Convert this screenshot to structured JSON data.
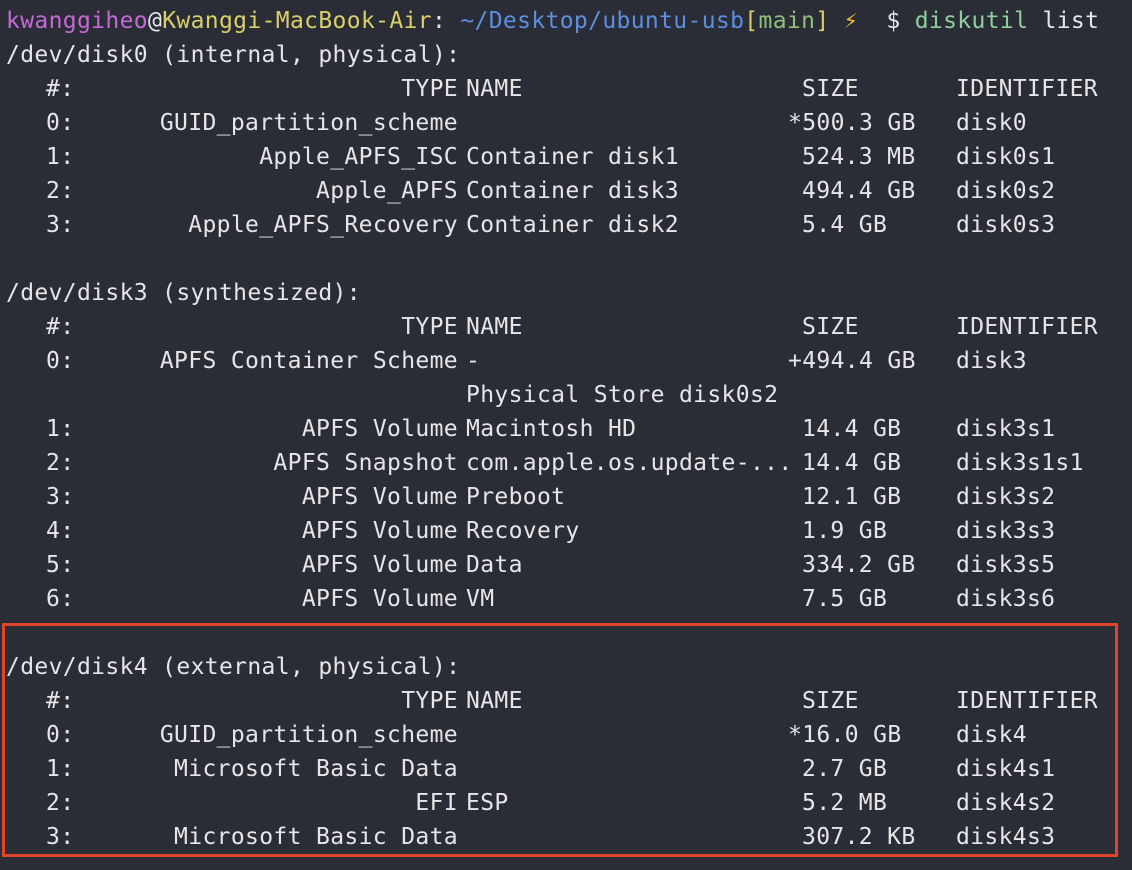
{
  "prompt": {
    "user": "kwanggiheo",
    "at": "@",
    "host": "Kwanggi-MacBook-Air",
    "colon": ": ",
    "path": "~/Desktop/ubuntu-usb",
    "branch_open": "[",
    "branch": "main",
    "branch_close": "]",
    "bolt": "⚡",
    "dollar": "$",
    "command": "diskutil",
    "argument": "list"
  },
  "disks": [
    {
      "header": "/dev/disk0 (internal, physical):",
      "columns": {
        "num": "#:",
        "type": "TYPE",
        "name": "NAME",
        "size": "SIZE",
        "identifier": "IDENTIFIER"
      },
      "rows": [
        {
          "num": "0:",
          "type": "GUID_partition_scheme",
          "name": "",
          "size": "*500.3 GB",
          "identifier": "disk0"
        },
        {
          "num": "1:",
          "type": "Apple_APFS_ISC",
          "name": "Container disk1",
          "size": "524.3 MB",
          "identifier": "disk0s1"
        },
        {
          "num": "2:",
          "type": "Apple_APFS",
          "name": "Container disk3",
          "size": "494.4 GB",
          "identifier": "disk0s2"
        },
        {
          "num": "3:",
          "type": "Apple_APFS_Recovery",
          "name": "Container disk2",
          "size": "5.4 GB",
          "identifier": "disk0s3"
        }
      ]
    },
    {
      "header": "/dev/disk3 (synthesized):",
      "columns": {
        "num": "#:",
        "type": "TYPE",
        "name": "NAME",
        "size": "SIZE",
        "identifier": "IDENTIFIER"
      },
      "rows": [
        {
          "num": "0:",
          "type": "APFS Container Scheme",
          "name": "-",
          "size": "+494.4 GB",
          "identifier": "disk3"
        },
        {
          "num": "",
          "type": "",
          "name": "Physical Store disk0s2",
          "size": "",
          "identifier": ""
        },
        {
          "num": "1:",
          "type": "APFS Volume",
          "name": "Macintosh HD",
          "size": "14.4 GB",
          "identifier": "disk3s1"
        },
        {
          "num": "2:",
          "type": "APFS Snapshot",
          "name": "com.apple.os.update-...",
          "size": "14.4 GB",
          "identifier": "disk3s1s1"
        },
        {
          "num": "3:",
          "type": "APFS Volume",
          "name": "Preboot",
          "size": "12.1 GB",
          "identifier": "disk3s2"
        },
        {
          "num": "4:",
          "type": "APFS Volume",
          "name": "Recovery",
          "size": "1.9 GB",
          "identifier": "disk3s3"
        },
        {
          "num": "5:",
          "type": "APFS Volume",
          "name": "Data",
          "size": "334.2 GB",
          "identifier": "disk3s5"
        },
        {
          "num": "6:",
          "type": "APFS Volume",
          "name": "VM",
          "size": "7.5 GB",
          "identifier": "disk3s6"
        }
      ]
    },
    {
      "header": "/dev/disk4 (external, physical):",
      "columns": {
        "num": "#:",
        "type": "TYPE",
        "name": "NAME",
        "size": "SIZE",
        "identifier": "IDENTIFIER"
      },
      "rows": [
        {
          "num": "0:",
          "type": "GUID_partition_scheme",
          "name": "",
          "size": "*16.0 GB",
          "identifier": "disk4"
        },
        {
          "num": "1:",
          "type": "Microsoft Basic Data",
          "name": "",
          "size": "2.7 GB",
          "identifier": "disk4s1"
        },
        {
          "num": "2:",
          "type": "EFI",
          "name": "ESP",
          "size": "5.2 MB",
          "identifier": "disk4s2"
        },
        {
          "num": "3:",
          "type": "Microsoft Basic Data",
          "name": "",
          "size": "307.2 KB",
          "identifier": "disk4s3"
        }
      ]
    }
  ],
  "colors": {
    "background": "#2b2d36",
    "highlight_border": "#e0442a",
    "user": "#c46ad6",
    "host": "#d9d06a",
    "path": "#5d8fe0",
    "branch": "#8fbf7a",
    "command": "#8fcf9f"
  }
}
